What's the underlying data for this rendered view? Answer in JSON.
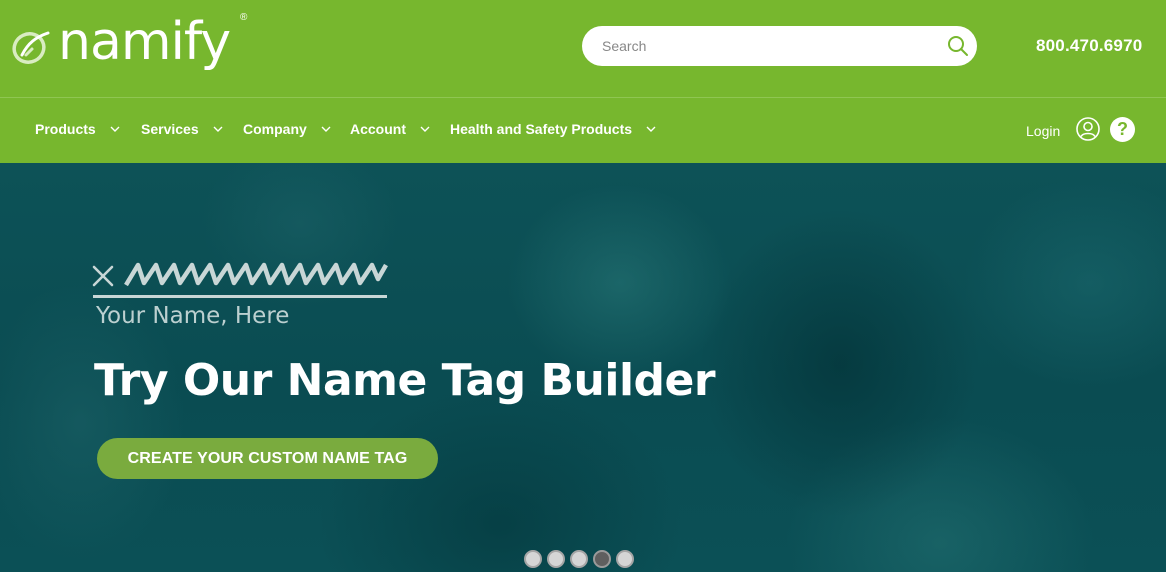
{
  "brand": {
    "name": "namify",
    "trademark": "®",
    "logo_icon": "namify-swirl-icon"
  },
  "colors": {
    "brand_green": "#77b72e",
    "cta_green": "#7aab3e",
    "hero_teal": "#0a4c52"
  },
  "search": {
    "placeholder": "Search",
    "value": "",
    "icon": "search-icon"
  },
  "phone": "800.470.6970",
  "nav": {
    "items": [
      {
        "label": "Products"
      },
      {
        "label": "Services"
      },
      {
        "label": "Company"
      },
      {
        "label": "Account"
      },
      {
        "label": "Health and Safety Products"
      }
    ],
    "login_label": "Login",
    "user_icon": "user-icon",
    "help_icon": "help-icon",
    "help_glyph": "?"
  },
  "hero": {
    "tag_mark": "✕",
    "tag_name": "Your Name, Here",
    "title": "Try Our Name Tag Builder",
    "cta_label": "CREATE YOUR CUSTOM NAME TAG"
  },
  "carousel": {
    "slide_count": 5,
    "active_index": 3
  }
}
